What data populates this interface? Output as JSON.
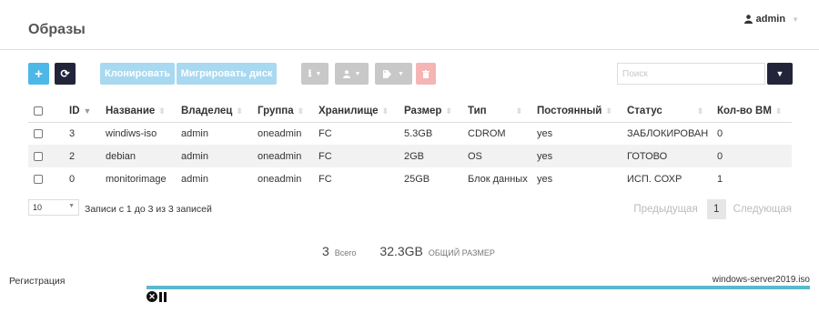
{
  "header": {
    "title": "Образы",
    "user": "admin"
  },
  "toolbar": {
    "add_icon": "+",
    "refresh_icon": "⟳",
    "clone_label": "Клонировать",
    "migrate_label": "Мигрировать диск",
    "search_placeholder": "Поиск"
  },
  "table": {
    "columns": [
      "ID",
      "Название",
      "Владелец",
      "Группа",
      "Хранилище",
      "Размер",
      "Тип",
      "Постоянный",
      "Статус",
      "Кол-во ВМ"
    ],
    "rows": [
      {
        "id": "3",
        "name": "windiws-iso",
        "owner": "admin",
        "group": "oneadmin",
        "datastore": "FC",
        "size": "5.3GB",
        "type": "CDROM",
        "persistent": "yes",
        "status": "ЗАБЛОКИРОВАН",
        "vms": "0"
      },
      {
        "id": "2",
        "name": "debian",
        "owner": "admin",
        "group": "oneadmin",
        "datastore": "FC",
        "size": "2GB",
        "type": "OS",
        "persistent": "yes",
        "status": "ГОТОВО",
        "vms": "0"
      },
      {
        "id": "0",
        "name": "monitorimage",
        "owner": "admin",
        "group": "oneadmin",
        "datastore": "FC",
        "size": "25GB",
        "type": "Блок данных",
        "persistent": "yes",
        "status": "ИСП. СОХР",
        "vms": "1"
      }
    ]
  },
  "footer": {
    "page_size": "10",
    "records_info": "Записи с 1 до 3 из 3 записей",
    "prev": "Предыдущая",
    "page": "1",
    "next": "Следующая"
  },
  "summary": {
    "count": "3",
    "count_label": "Всего",
    "size": "32.3GB",
    "size_label": "ОБЩИЙ РАЗМЕР"
  },
  "upload": {
    "label": "Регистрация",
    "filename": "windows-server2019.iso",
    "progress": 1.0
  },
  "colors": {
    "accent": "#4db8e8",
    "dark": "#22253a",
    "progress": "#5cb8cc"
  }
}
